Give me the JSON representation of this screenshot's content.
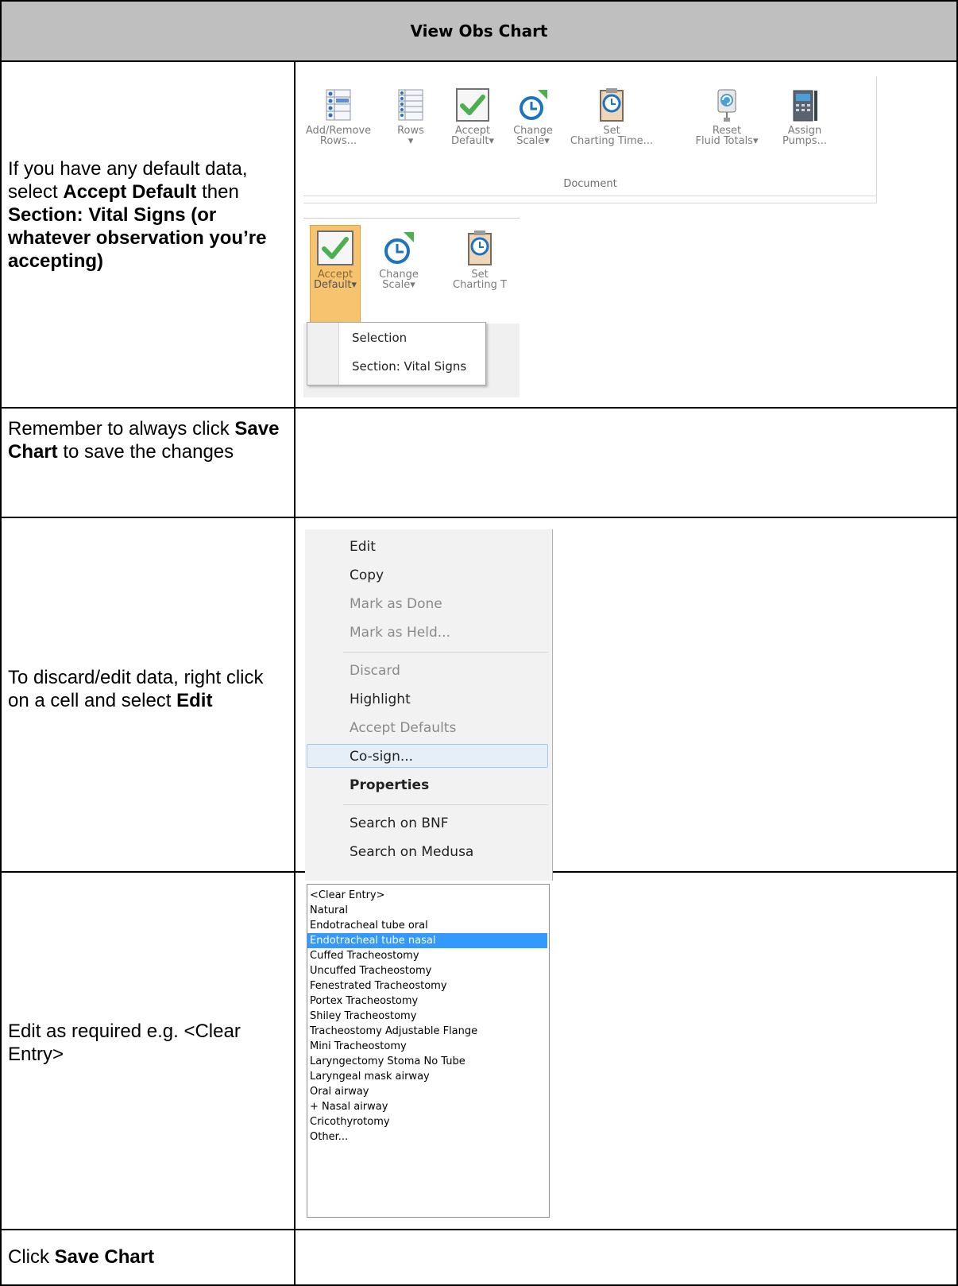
{
  "header": {
    "title": "View Obs Chart"
  },
  "rows": {
    "r1": {
      "pre": "If you have any default data, select ",
      "b1": "Accept Default",
      "mid": " then ",
      "b2": "Section: Vital Signs (or whatever observation you’re accepting)"
    },
    "r2": {
      "pre": "Remember to always click ",
      "b1": "Save Chart",
      "post": " to save the changes"
    },
    "r3": {
      "pre": "To discard/edit data, right click on a cell and select ",
      "b1": "Edit"
    },
    "r4": {
      "text": "Edit as required e.g. <Clear Entry>"
    },
    "r5": {
      "pre": "Click ",
      "b1": "Save Chart"
    }
  },
  "ribbon": {
    "buttons": [
      {
        "line1": "Add/Remove",
        "line2": "Rows...",
        "icon": "add-remove-rows-icon"
      },
      {
        "line1": "Rows",
        "line2": "▾",
        "icon": "rows-icon"
      },
      {
        "line1": "Accept",
        "line2": "Default▾",
        "icon": "accept-checkmark-icon"
      },
      {
        "line1": "Change",
        "line2": "Scale▾",
        "icon": "clock-arrow-icon"
      },
      {
        "line1": "Set",
        "line2": "Charting Time...",
        "icon": "clock-clipboard-icon"
      },
      {
        "line1": "Reset",
        "line2": "Fluid Totals▾",
        "icon": "fluid-bag-icon"
      },
      {
        "line1": "Assign",
        "line2": "Pumps...",
        "icon": "pump-icon"
      }
    ],
    "group_label": "Document"
  },
  "ribbon_zoom": {
    "buttons": [
      {
        "line1": "Accept",
        "line2": "Default▾"
      },
      {
        "line1": "Change",
        "line2": "Scale▾"
      },
      {
        "line1": "Set",
        "line2": "Charting T"
      }
    ],
    "dropdown": [
      "Selection",
      "Section: Vital Signs"
    ]
  },
  "context_menu": {
    "items": [
      {
        "label": "Edit",
        "state": "enabled"
      },
      {
        "label": "Copy",
        "state": "enabled"
      },
      {
        "label": "Mark as Done",
        "state": "disabled"
      },
      {
        "label": "Mark as Held...",
        "state": "disabled"
      },
      {
        "label": "Discard",
        "state": "disabled"
      },
      {
        "label": "Highlight",
        "state": "enabled"
      },
      {
        "label": "Accept Defaults",
        "state": "disabled"
      },
      {
        "label": "Co-sign...",
        "state": "hovered"
      },
      {
        "label": "Properties",
        "state": "bold"
      },
      {
        "label": "Search on BNF",
        "state": "enabled"
      },
      {
        "label": "Search on Medusa",
        "state": "enabled"
      }
    ]
  },
  "listbox": {
    "selected": "Endotracheal tube nasal",
    "options": [
      "<Clear Entry>",
      "Natural",
      "Endotracheal tube oral",
      "Endotracheal tube nasal",
      "Cuffed Tracheostomy",
      "Uncuffed Tracheostomy",
      "Fenestrated Tracheostomy",
      "Portex Tracheostomy",
      "Shiley Tracheostomy",
      "Tracheostomy Adjustable Flange",
      "Mini Tracheostomy",
      "Laryngectomy Stoma No Tube",
      "Laryngeal mask airway",
      "Oral airway",
      "+ Nasal airway",
      "Cricothyrotomy",
      "Other..."
    ]
  },
  "colors": {
    "header_bg": "#bfbfbf",
    "accept_highlight": "#f8c36e",
    "selection_blue": "#3399ff",
    "check_green": "#4caf50",
    "clock_blue": "#1e73be"
  }
}
